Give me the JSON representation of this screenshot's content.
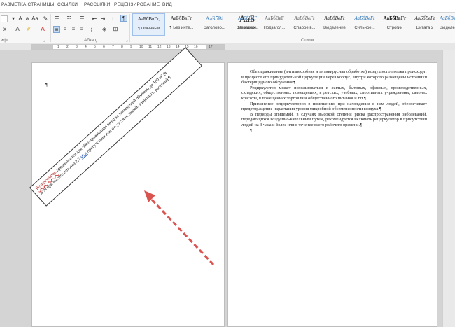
{
  "tabs": [
    "РАЗМЕТКА СТРАНИЦЫ",
    "ССЫЛКИ",
    "РАССЫЛКИ",
    "РЕЦЕНЗИРОВАНИЕ",
    "ВИД"
  ],
  "ribbon": {
    "group_font": "ифт",
    "group_paragraph": "Абзац",
    "group_styles": "Стили",
    "styles": [
      {
        "sample": "АаБбВвГг,",
        "name": "¶ Обычный"
      },
      {
        "sample": "АаБбВвГг,",
        "name": "¶ Без инте..."
      },
      {
        "sample": "АаБбВі",
        "name": "Заголово..."
      },
      {
        "sample": "АаБбВвГ",
        "name": "Заголово..."
      },
      {
        "sample": "АаБ",
        "name": "Название"
      },
      {
        "sample": "АаБбВвГ",
        "name": "Подзагол..."
      },
      {
        "sample": "АаБбВвГг",
        "name": "Слабое в..."
      },
      {
        "sample": "АаБбВвГг",
        "name": "Выделение"
      },
      {
        "sample": "АаБбВвГг",
        "name": "Сильное..."
      },
      {
        "sample": "АаБбВвГг",
        "name": "Строгий"
      },
      {
        "sample": "АаБбВвГг",
        "name": "Цитата 2"
      },
      {
        "sample": "АаБбВвГг",
        "name": "Выделенн..."
      },
      {
        "sample": "АаБбВвГг",
        "name": "Слабая сс..."
      }
    ]
  },
  "ruler_numbers": [
    "1",
    "2",
    "3",
    "4",
    "5",
    "6",
    "7",
    "8",
    "9",
    "10",
    "11",
    "12",
    "13",
    "14",
    "15",
    "16",
    "17"
  ],
  "textbox": {
    "line1_word": "Рециркулятор",
    "line1_rest": " предназначен для обеззараживания воздуха помещений объемом до 100 м³ (в",
    "line2_start": "м³/ч при высоте потолка 2,7 ",
    "line2_link": "м) в",
    "line2_rest": " присутствии или отсутствии людей, животных, растений.¶"
  },
  "paragraphs": [
    "Обеззараживание (антимикробная и антивирусная обработка) воздушного потока происходит в процессе его принудительной циркуляции через корпус, внутри которого размещены источники бактерицидного облучения.¶",
    "Рециркулятор может использоваться в жилых, бытовых, офисных, производственных, складских, общественных помещениях, в детских, учебных, спортивных учреждениях, салонах красоты, в помещениях торговли и общественного питания и т.п.¶",
    "Применение рециркуляторов в помещении, при нахождении в нем людей, обеспечивает предотвращение нарастания уровня микробной обсемененности воздуха.¶",
    "В периоды эпидемий, в случаях высокой степени риска распространения заболеваний, передающихся воздушно-капельным путем, рекомендуется включать рециркулятор в присутствии людей на 3 часа и более или в течение всего рабочего времени.¶"
  ],
  "para_mark": "¶",
  "colors": {
    "arrow": "#d9534f",
    "ribbon_bg": "#f7f7f7",
    "workspace": "#d4d4d4"
  }
}
